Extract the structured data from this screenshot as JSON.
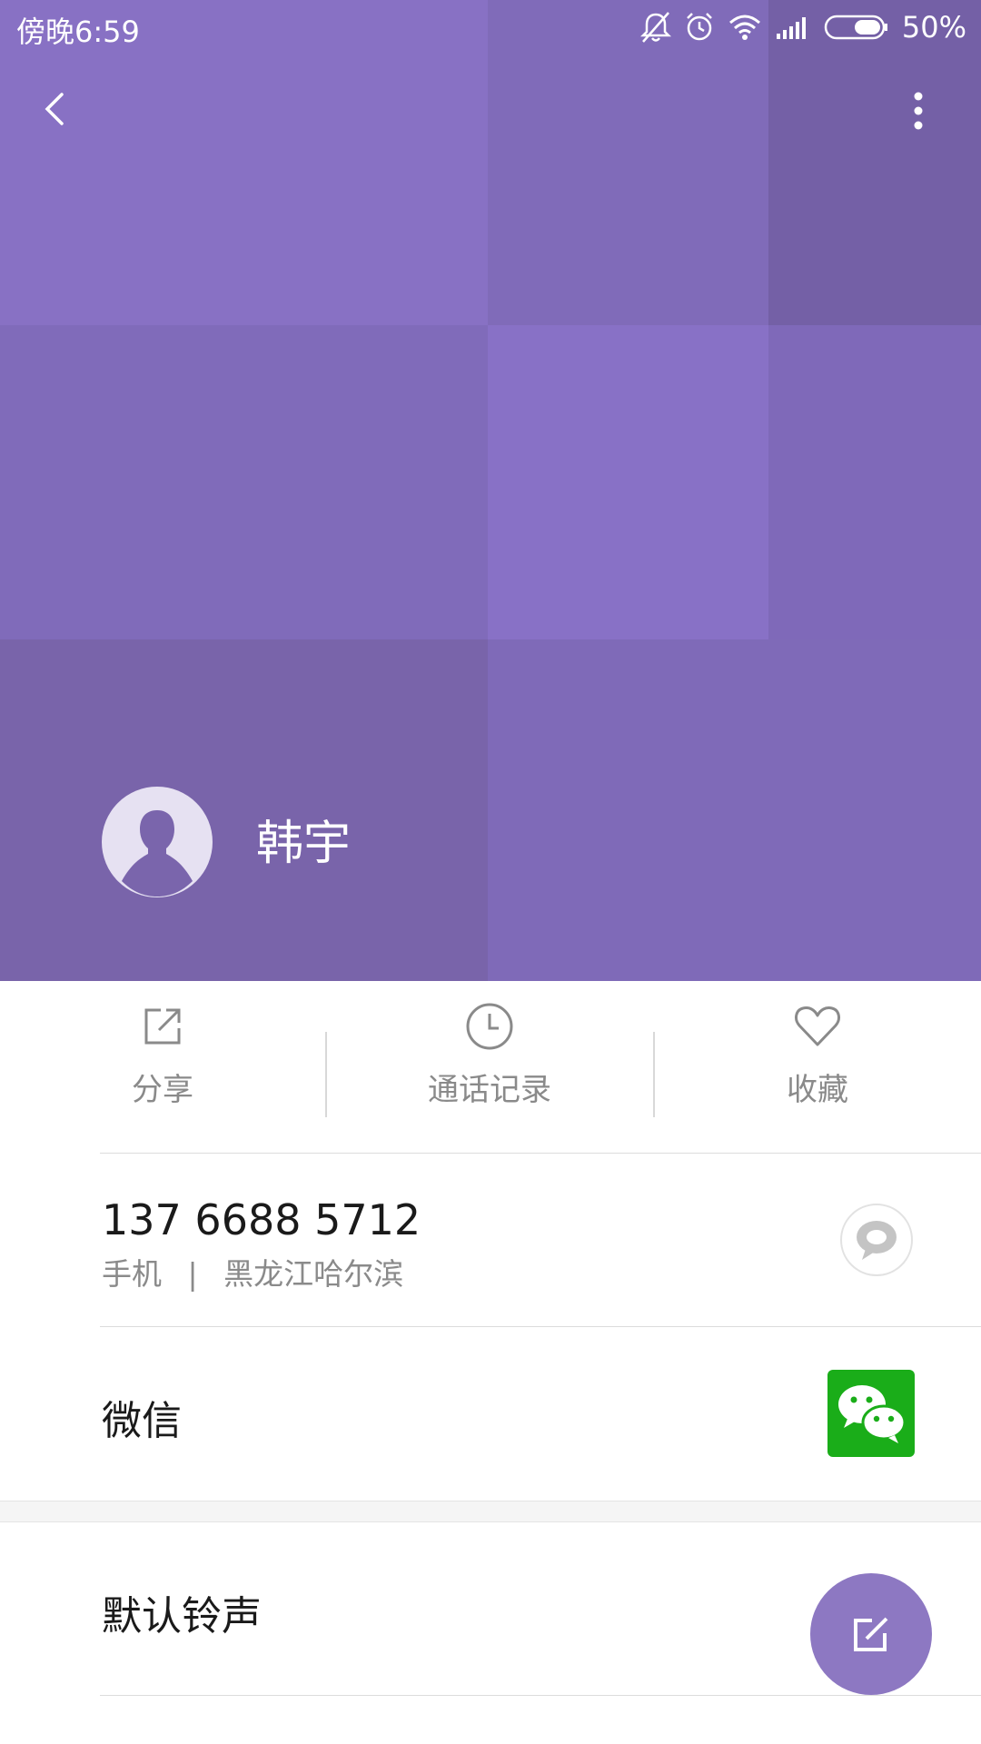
{
  "status_bar": {
    "time": "傍晚6:59",
    "battery_percent": "50%",
    "icons": [
      "mute-bell-icon",
      "alarm-icon",
      "wifi-icon",
      "signal-icon",
      "battery-icon"
    ]
  },
  "nav": {
    "back_icon": "back-arrow-icon",
    "more_icon": "more-vert-icon"
  },
  "contact": {
    "name": "韩宇",
    "avatar_icon": "person-silhouette-icon"
  },
  "actions": [
    {
      "label": "分享",
      "icon": "share-icon"
    },
    {
      "label": "通话记录",
      "icon": "clock-icon"
    },
    {
      "label": "收藏",
      "icon": "heart-icon"
    }
  ],
  "phone": {
    "number": "137 6688 5712",
    "type": "手机",
    "separator": "|",
    "location": "黑龙江哈尔滨",
    "message_icon": "message-bubble-icon"
  },
  "wechat": {
    "label": "微信",
    "icon": "wechat-icon"
  },
  "ringtone": {
    "label": "默认铃声"
  },
  "fab": {
    "icon": "edit-icon"
  },
  "colors": {
    "header": "#806bb8",
    "fab": "#8d78c2",
    "wechat_green": "#1aad19"
  }
}
